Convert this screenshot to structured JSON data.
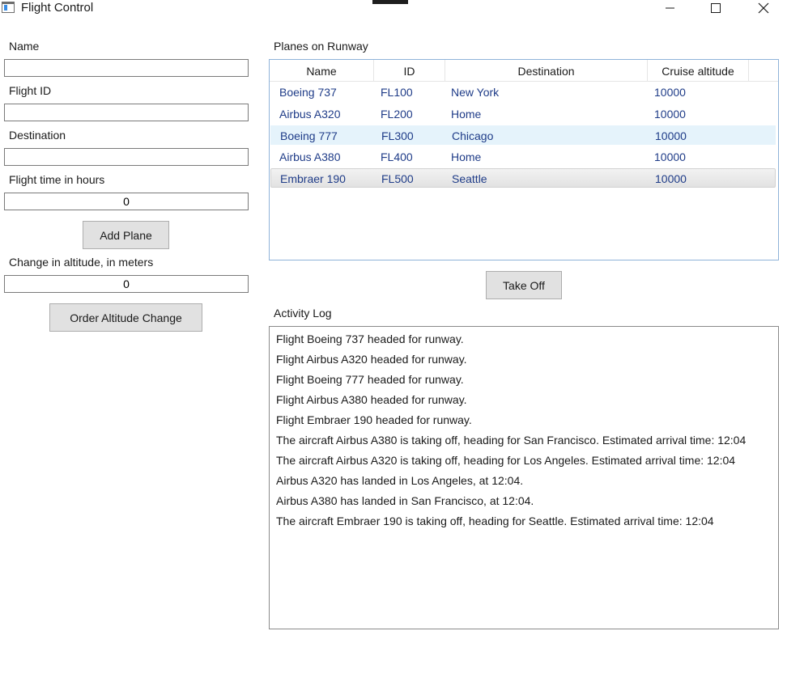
{
  "window": {
    "title": "Flight Control"
  },
  "form": {
    "name_label": "Name",
    "name_value": "",
    "flight_id_label": "Flight ID",
    "flight_id_value": "",
    "destination_label": "Destination",
    "destination_value": "",
    "flight_time_label": "Flight time in hours",
    "flight_time_value": "0",
    "add_plane_label": "Add Plane",
    "altitude_change_label": "Change in altitude, in meters",
    "altitude_change_value": "0",
    "order_altitude_label": "Order Altitude Change"
  },
  "runway": {
    "label": "Planes on Runway",
    "columns": [
      "Name",
      "ID",
      "Destination",
      "Cruise altitude"
    ],
    "rows": [
      {
        "name": "Boeing 737",
        "id": "FL100",
        "destination": "New York",
        "altitude": "10000",
        "state": "normal"
      },
      {
        "name": "Airbus A320",
        "id": "FL200",
        "destination": "Home",
        "altitude": "10000",
        "state": "normal"
      },
      {
        "name": "Boeing 777",
        "id": "FL300",
        "destination": "Chicago",
        "altitude": "10000",
        "state": "hover"
      },
      {
        "name": "Airbus A380",
        "id": "FL400",
        "destination": "Home",
        "altitude": "10000",
        "state": "normal"
      },
      {
        "name": "Embraer 190",
        "id": "FL500",
        "destination": "Seattle",
        "altitude": "10000",
        "state": "selected"
      }
    ],
    "take_off_label": "Take Off"
  },
  "activity": {
    "label": "Activity Log",
    "lines": [
      "Flight Boeing 737 headed for runway.",
      "Flight Airbus A320 headed for runway.",
      "Flight Boeing 777 headed for runway.",
      "Flight Airbus A380 headed for runway.",
      "Flight Embraer 190 headed for runway.",
      "The aircraft Airbus A380 is taking off, heading for San Francisco. Estimated arrival time: 12:04",
      "The aircraft Airbus A320 is taking off, heading for Los Angeles. Estimated arrival time: 12:04",
      "Airbus A320 has landed in Los Angeles, at 12:04.",
      "Airbus A380 has landed in San Francisco, at 12:04.",
      "The aircraft Embraer 190 is taking off, heading for Seattle. Estimated arrival time: 12:04"
    ]
  },
  "icons": {
    "app": "app-window-icon",
    "minimize": "minimize-icon",
    "maximize": "maximize-icon",
    "close": "close-icon"
  }
}
